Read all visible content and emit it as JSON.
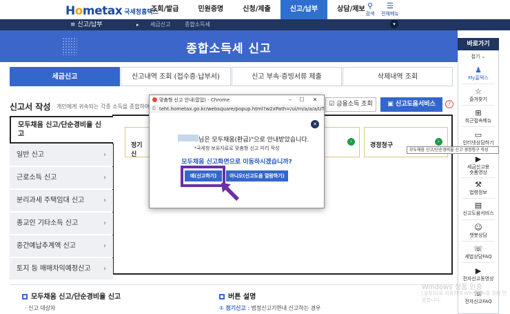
{
  "header": {
    "logo_main_pre": "H",
    "logo_main_o": "o",
    "logo_main_post": "metax",
    "logo_sub": "국세청홈택스",
    "nav": [
      "조회/발급",
      "민원증명",
      "신청/제출",
      "신고/납부",
      "상담/제보"
    ],
    "active_nav_index": 3,
    "search_label": "검색",
    "all_menu_label": "전체메뉴"
  },
  "subbar": {
    "menu_label": "≡ 신고/납부",
    "crumbs": [
      "세금신고",
      "종합소득세"
    ]
  },
  "banner": {
    "title": "종합소득세 신고"
  },
  "tabs": [
    "세금신고",
    "신고내역 조회 (접수증·납부서)",
    "신고 부속·증빙서류 제출",
    "삭제내역 조회"
  ],
  "section": {
    "title": "신고서 작성",
    "desc": "개인에게 귀속되는 각종 소득을 종합하여 과",
    "finance_btn": "금융소득 조회",
    "help_service_btn": "신고도움서비스"
  },
  "side_menu": {
    "main": "모두채움 신고/단순경비율 신고",
    "items": [
      "일반 신고",
      "근로소득 신고",
      "분리과세 주택임대 신고",
      "종교인 기타소득 신고",
      "중간예납추계액 신고",
      "토지 등 매매차익예정신고"
    ]
  },
  "cards": {
    "left": "정기신",
    "right": "경정청구"
  },
  "bottom": {
    "left_title": "모두채움 신고/단순경비율 신고",
    "left_text": "· 신고 대상자",
    "right_title": "버튼 설명",
    "right_num": "①",
    "right_text_key": "정기신고",
    "right_text": " : 법정신고기한내 신고하는 경우"
  },
  "quick_panel": {
    "title": "바로가기",
    "fold": "접기 ⌄",
    "items": [
      {
        "label": "My홈택스",
        "icon": "person-icon"
      },
      {
        "label": "즐겨찾기",
        "icon": "star-icon"
      },
      {
        "label": "최근접속메뉴",
        "icon": "history-icon"
      },
      {
        "label": "인터넷상담하기",
        "icon": "chat-icon"
      },
      {
        "label": "세금신고용\n숏폼영상",
        "icon": "video-icon"
      },
      {
        "label": "법령정보",
        "icon": "gavel-icon"
      },
      {
        "label": "신고도움서비스",
        "icon": "document-icon"
      },
      {
        "label": "챗봇상담",
        "icon": "chatbot-icon"
      },
      {
        "label": "세법상담FAQ",
        "icon": "faq-icon"
      },
      {
        "label": "전자신고동영상",
        "icon": "video-icon"
      },
      {
        "label": "전자신고FAQ",
        "icon": "faq-icon"
      }
    ],
    "tooltip": "모두채움 신고/단순경비율 신고 경정청구 작성"
  },
  "watermark": {
    "line1": "Windows 정품 인증",
    "line2": "[설정]으로 이동하여 Windows를 정품 인증합니다."
  },
  "popup": {
    "title": "맞춤형 신고 안내(팝업) - Chrome",
    "url": "teht.hometax.go.kr/websquare/popup.html?w2xPath=/ui/rn/a/a/a/UT...",
    "line1": "님은 모두채움(환급)\"으로 안내받았습니다.",
    "line2": "*국세청 보유자료로 맞춤형 신고 미리 작성",
    "line3": "모두채움 신고화면으로 이동하시겠습니까?",
    "yes_btn": "예(신고하기)",
    "no_btn": "아니오(신고도움 열람하기)"
  },
  "colors": {
    "brand_blue": "#3467cb",
    "navy": "#20355f",
    "highlight_purple": "#6c2fa5"
  }
}
